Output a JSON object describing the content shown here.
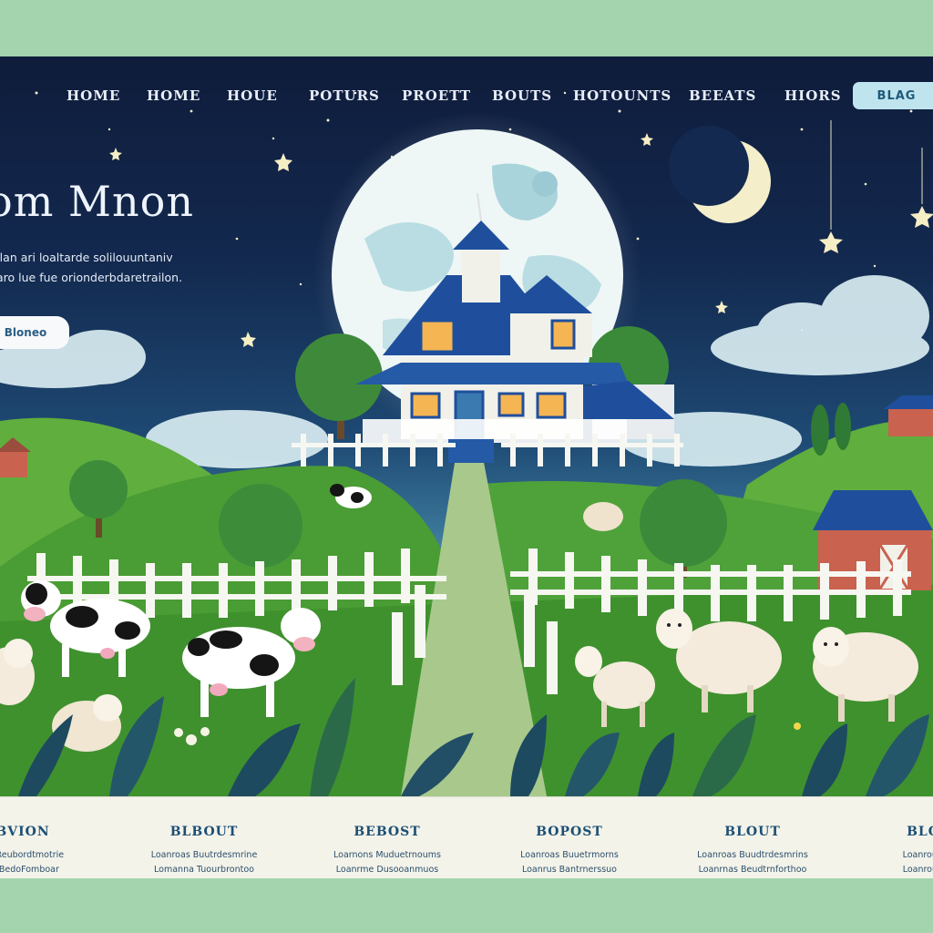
{
  "nav": {
    "items": [
      "HOME",
      "HOME",
      "HOUE",
      "POTURS",
      "PROETT",
      "BOUTS",
      "HOTOUNTS",
      "BEEATS",
      "HIORS"
    ],
    "button_label": "BLAG"
  },
  "hero": {
    "title": "om Mnon",
    "subtitle_lines": [
      "Ilan ari loaltarde solilouuntaniv",
      "aro lue fue orionderbdaretrailon."
    ],
    "button_label": "Bloneo"
  },
  "footer": {
    "columns": [
      {
        "heading": "BVION",
        "lines": [
          "Tol Reubordtmotrie",
          "Fe BedoFomboar"
        ]
      },
      {
        "heading": "BLBOUT",
        "lines": [
          "Loanroas Buutrdesmrine",
          "Lomanna Tuourbrontoo"
        ]
      },
      {
        "heading": "BEBOST",
        "lines": [
          "Loarnons Muduetrnoums",
          "Loanrme Dusooanmuos"
        ]
      },
      {
        "heading": "BOPOST",
        "lines": [
          "Loanroas Buuetrmorns",
          "Loanrus Bantrnerssuo"
        ]
      },
      {
        "heading": "BLOUT",
        "lines": [
          "Loanroas Buudtrdesmrins",
          "Loanrnas Beudtrnforthoo"
        ]
      },
      {
        "heading": "BLOG",
        "lines": [
          "Loanrous Bu",
          "Loanrous Bo"
        ]
      }
    ]
  },
  "icons": [
    "moon-icon",
    "crescent-moon-icon",
    "star-icon",
    "house-icon",
    "barn-icon",
    "cow-icon",
    "sheep-icon",
    "tree-icon",
    "fence-icon"
  ]
}
